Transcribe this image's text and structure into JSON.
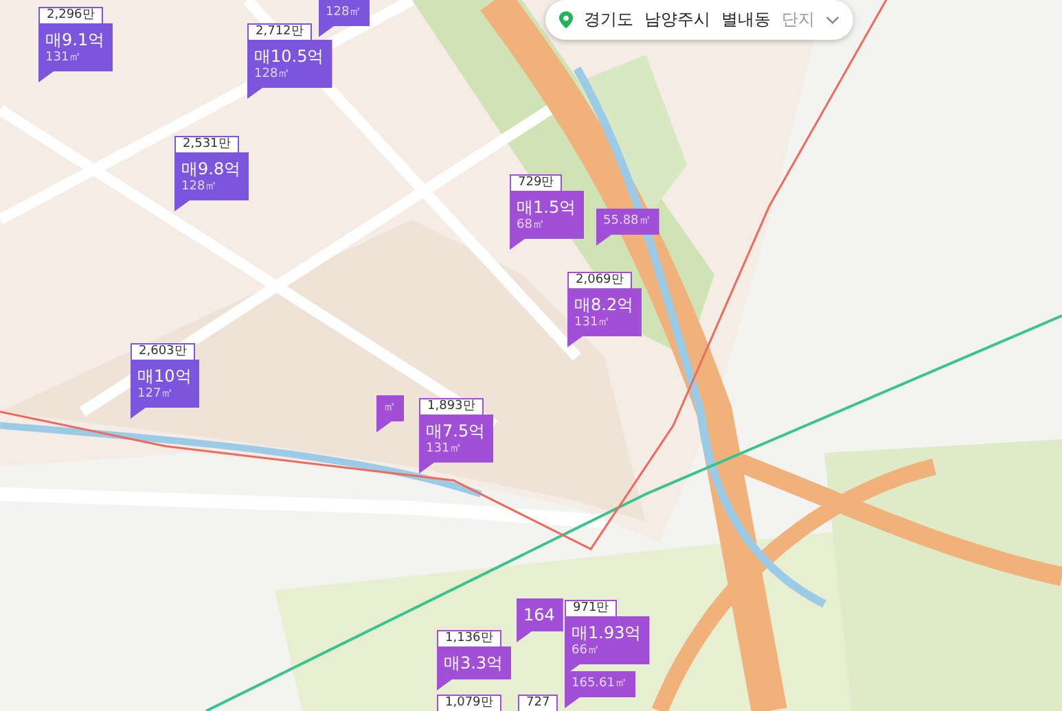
{
  "breadcrumb": {
    "items": [
      {
        "label": "경기도",
        "selected": true
      },
      {
        "label": "남양주시",
        "selected": true
      },
      {
        "label": "별내동",
        "selected": true
      },
      {
        "label": "단지",
        "selected": false
      }
    ]
  },
  "markers": [
    {
      "note": "2,296만",
      "price": "매9.1억",
      "area": "131㎡",
      "color": "#7b55de"
    },
    {
      "area": "128㎡",
      "color": "#7b55de"
    },
    {
      "note": "2,712만",
      "price": "매10.5억",
      "area": "128㎡",
      "color": "#7b55de"
    },
    {
      "note": "2,531만",
      "price": "매9.8억",
      "area": "128㎡",
      "color": "#7b55de"
    },
    {
      "note": "2,603만",
      "price": "매10억",
      "area": "127㎡",
      "color": "#7b55de"
    },
    {
      "area": "55.88㎡",
      "color": "#a04fd6"
    },
    {
      "note": "729만",
      "price": "매1.5억",
      "area": "68㎡",
      "color": "#a04fd6"
    },
    {
      "note": "2,069만",
      "price": "매8.2억",
      "area": "131㎡",
      "color": "#a04fd6"
    },
    {
      "area": "㎡",
      "color": "#a04fd6"
    },
    {
      "note": "1,893만",
      "price": "매7.5억",
      "area": "131㎡",
      "color": "#a04fd6"
    },
    {
      "price": "164",
      "color": "#a04fd6"
    },
    {
      "note": "971만",
      "price": "매1.93억",
      "area": "66㎡",
      "color": "#a04fd6"
    },
    {
      "area": "165.61㎡",
      "color": "#a04fd6"
    },
    {
      "note": "1,136만",
      "price": "매3.3억",
      "color": "#a04fd6"
    },
    {
      "note": "727",
      "color": "#a04fd6"
    },
    {
      "note": "1,079만",
      "color": "#a04fd6"
    }
  ]
}
